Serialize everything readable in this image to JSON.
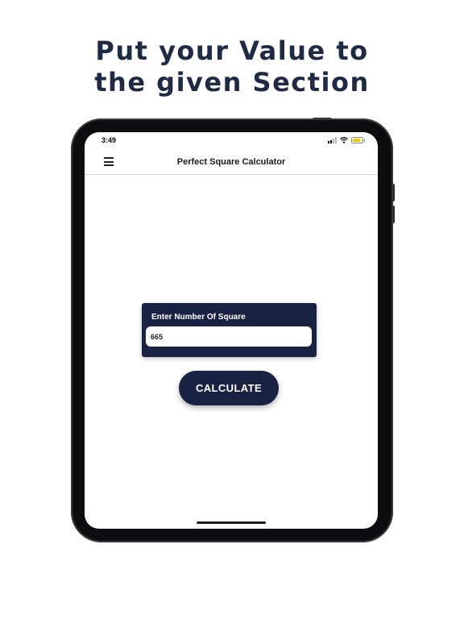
{
  "headline": {
    "line1": "Put your Value to",
    "line2": "the given Section"
  },
  "status_bar": {
    "time": "3:49",
    "icons": [
      "cellular-signal-icon",
      "wifi-icon",
      "battery-icon"
    ],
    "battery_color": "#f5c400"
  },
  "app_bar": {
    "menu_icon": "hamburger-menu-icon",
    "title": "Perfect Square Calculator"
  },
  "form": {
    "label": "Enter Number Of Square",
    "input_value": "665",
    "button_label": "CALCULATE"
  },
  "colors": {
    "headline": "#1f2a44",
    "accent": "#1a2244",
    "device_frame": "#0d0d0f"
  }
}
